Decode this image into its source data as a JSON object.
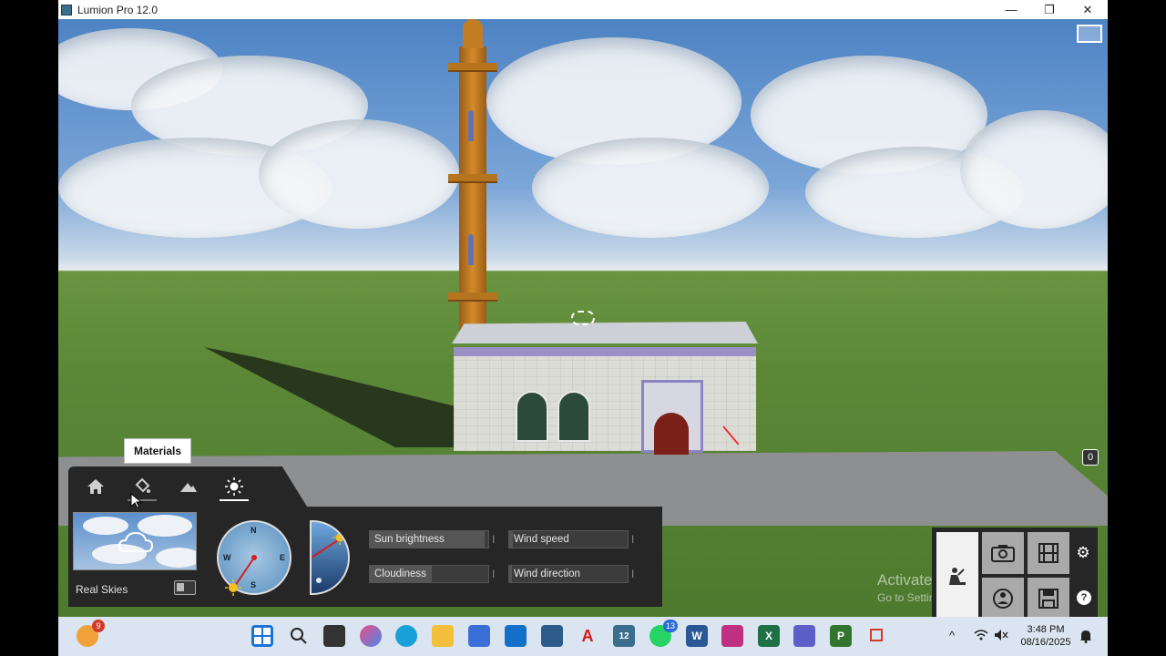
{
  "window": {
    "title": "Lumion Pro 12.0",
    "minimize": "—",
    "restore": "❐",
    "close": "✕"
  },
  "viewport": {
    "zero_label": "0"
  },
  "tooltip": {
    "text": "Materials"
  },
  "tabs": [
    {
      "name": "home",
      "icon": "home-icon",
      "active": false
    },
    {
      "name": "materials",
      "icon": "paint-bucket-icon",
      "active": false
    },
    {
      "name": "landscape",
      "icon": "mountain-icon",
      "active": false
    },
    {
      "name": "weather",
      "icon": "sun-icon",
      "active": true
    }
  ],
  "weather": {
    "real_skies_label": "Real Skies",
    "compass": {
      "n": "N",
      "e": "E",
      "s": "S",
      "w": "W"
    },
    "sun_brightness": {
      "label": "Sun brightness",
      "level": 0.97
    },
    "wind_speed": {
      "label": "Wind speed",
      "level": 0.03
    },
    "cloudiness": {
      "label": "Cloudiness",
      "level": 0.52
    },
    "wind_direction": {
      "label": "Wind direction",
      "level": 0.02
    }
  },
  "modes": {
    "build": "build-mode-icon",
    "photo": "camera-icon",
    "movie": "film-icon",
    "panorama": "panorama-icon",
    "save": "save-icon",
    "settings": "⚙",
    "help": "?"
  },
  "watermark": {
    "line1": "Activate Windows",
    "line2": "Go to Settings to activate Windows."
  },
  "taskbar": {
    "weather_badge": "9",
    "whatsapp_badge": "13",
    "lumion_label": "12",
    "acrobat_label": "A",
    "word_label": "W",
    "excel_label": "X",
    "project_label": "P",
    "time": "3:48 PM",
    "date": "08/16/2025"
  },
  "colors": {
    "panel": "#262626",
    "taskbar": "#dbe5f1",
    "sky": "#4d83c4",
    "grass": "#5b8737"
  }
}
